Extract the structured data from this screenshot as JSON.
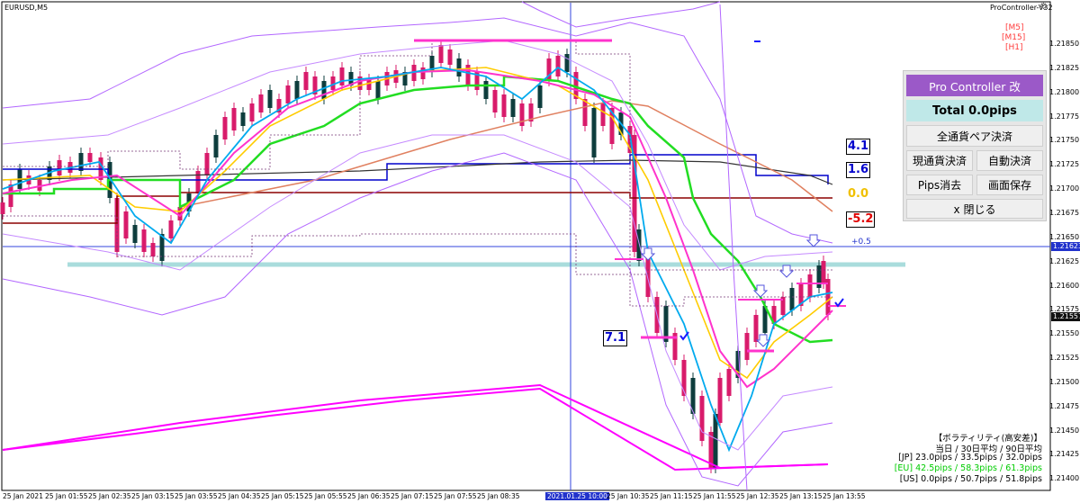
{
  "symbol_label": "EURUSD,M5",
  "indicator_name": "ProController-V32",
  "timeframe_tags": [
    "[M5]",
    "[M15]",
    "[H1]"
  ],
  "price_axis": [
    "1.21850",
    "1.21825",
    "1.21800",
    "1.21775",
    "1.21750",
    "1.21725",
    "1.21700",
    "1.21675",
    "1.21650",
    "1.21625",
    "1.21600",
    "1.21575",
    "1.21550",
    "1.21525",
    "1.21500",
    "1.21475",
    "1.21450",
    "1.21425",
    "1.21400"
  ],
  "current_price": "1.21557",
  "hline_price": "1.21623",
  "hline_label": "+0.5",
  "time_axis": [
    "25 Jan 2021",
    "25 Jan 01:55",
    "25 Jan 02:35",
    "25 Jan 03:15",
    "25 Jan 03:55",
    "25 Jan 04:35",
    "25 Jan 05:15",
    "25 Jan 05:55",
    "25 Jan 06:35",
    "25 Jan 07:15",
    "25 Jan 07:55",
    "25 Jan 08:35",
    "2021.01.25 10:00",
    "25 Jan 10:35",
    "25 Jan 11:15",
    "25 Jan 11:55",
    "25 Jan 12:35",
    "25 Jan 13:15",
    "25 Jan 13:55"
  ],
  "panel": {
    "title": "Pro Controller 改",
    "total": "Total    0.0pips",
    "close_all_pairs": "全通貨ペア決済",
    "close_current": "現通貨決済",
    "auto_close": "自動決済",
    "clear_pips": "Pips消去",
    "save_screen": "画面保存",
    "close_panel": "x 閉じる"
  },
  "numbers": {
    "n1": "4.1",
    "n2": "1.6",
    "n3": "0.0",
    "n4": "-5.2",
    "n5": "7.1"
  },
  "volatility": {
    "title": "【ボラティリティ(高安差)】",
    "header": "当日 / 30日平均 / 90日平均",
    "jp": "[JP] 23.0pips / 33.5pips / 32.0pips",
    "eu": "[EU] 42.5pips / 58.3pips / 61.3pips",
    "us": "[US] 0.0pips / 50.7pips / 51.8pips"
  },
  "colors": {
    "bull": "#d81b6b",
    "bear": "#0e3d3d",
    "green_line": "#00e000",
    "blue_line": "#0000cc",
    "magenta": "#ff00ff",
    "panel_title_bg": "#9b59c8",
    "panel_total_bg": "#bfe8e8"
  }
}
